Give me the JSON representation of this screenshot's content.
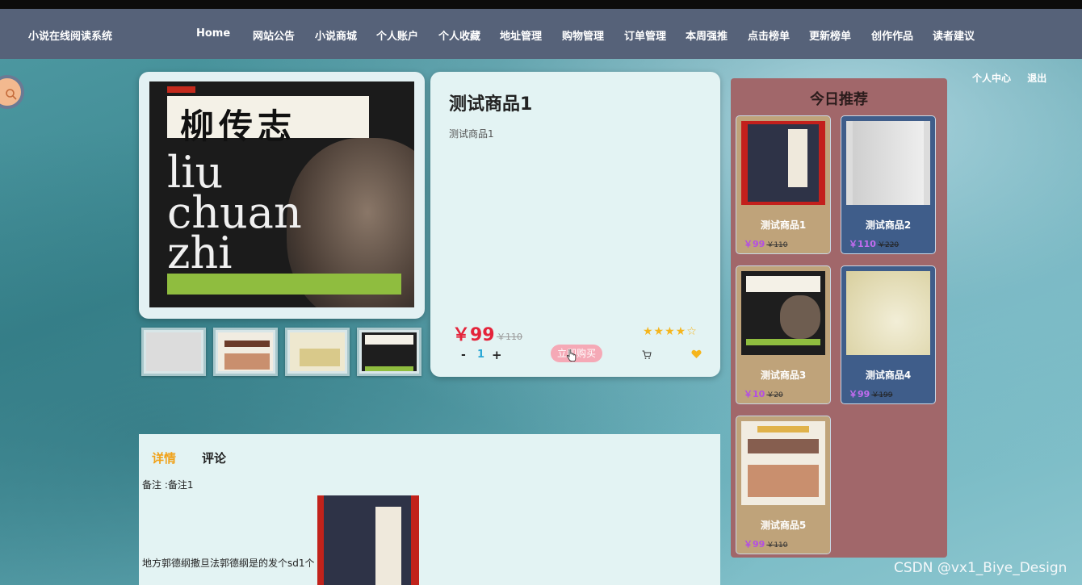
{
  "nav": {
    "brand": "小说在线阅读系统",
    "items": [
      "Home",
      "网站公告",
      "小说商城",
      "个人账户",
      "个人收藏",
      "地址管理",
      "购物管理",
      "订单管理",
      "本周强推",
      "点击榜单",
      "更新榜单",
      "创作作品",
      "读者建议"
    ]
  },
  "user_links": {
    "center": "个人中心",
    "logout": "退出"
  },
  "main_cover": {
    "title_cn": "柳传志",
    "title_en_1": "liu",
    "title_en_2": "chuan",
    "title_en_3": "zhi"
  },
  "product": {
    "title": "测试商品1",
    "subtitle": "测试商品1",
    "price": "￥99",
    "old_price": "￥110",
    "rating_stars": "★★★★☆",
    "qty_minus": "-",
    "qty": "1",
    "qty_plus": "+",
    "buy_label": "立即购买"
  },
  "reco": {
    "title": "今日推荐",
    "items": [
      {
        "name": "测试商品1",
        "price": "￥99",
        "old": "￥110"
      },
      {
        "name": "测试商品2",
        "price": "￥110",
        "old": "￥220"
      },
      {
        "name": "测试商品3",
        "price": "￥10",
        "old": "￥20"
      },
      {
        "name": "测试商品4",
        "price": "￥99",
        "old": "￥199"
      },
      {
        "name": "测试商品5",
        "price": "￥99",
        "old": "￥110"
      }
    ]
  },
  "detail": {
    "tab_detail": "详情",
    "tab_comment": "评论",
    "remark": "备注 :备注1",
    "description": "地方郭德纲撒旦法郭德纲是的发个sd1个"
  },
  "watermark": "CSDN @vx1_Biye_Design",
  "colors": {
    "nav": "#566279",
    "price": "#e4233a",
    "accent_tab": "#f0a21a",
    "reco_panel": "#a1676a"
  }
}
